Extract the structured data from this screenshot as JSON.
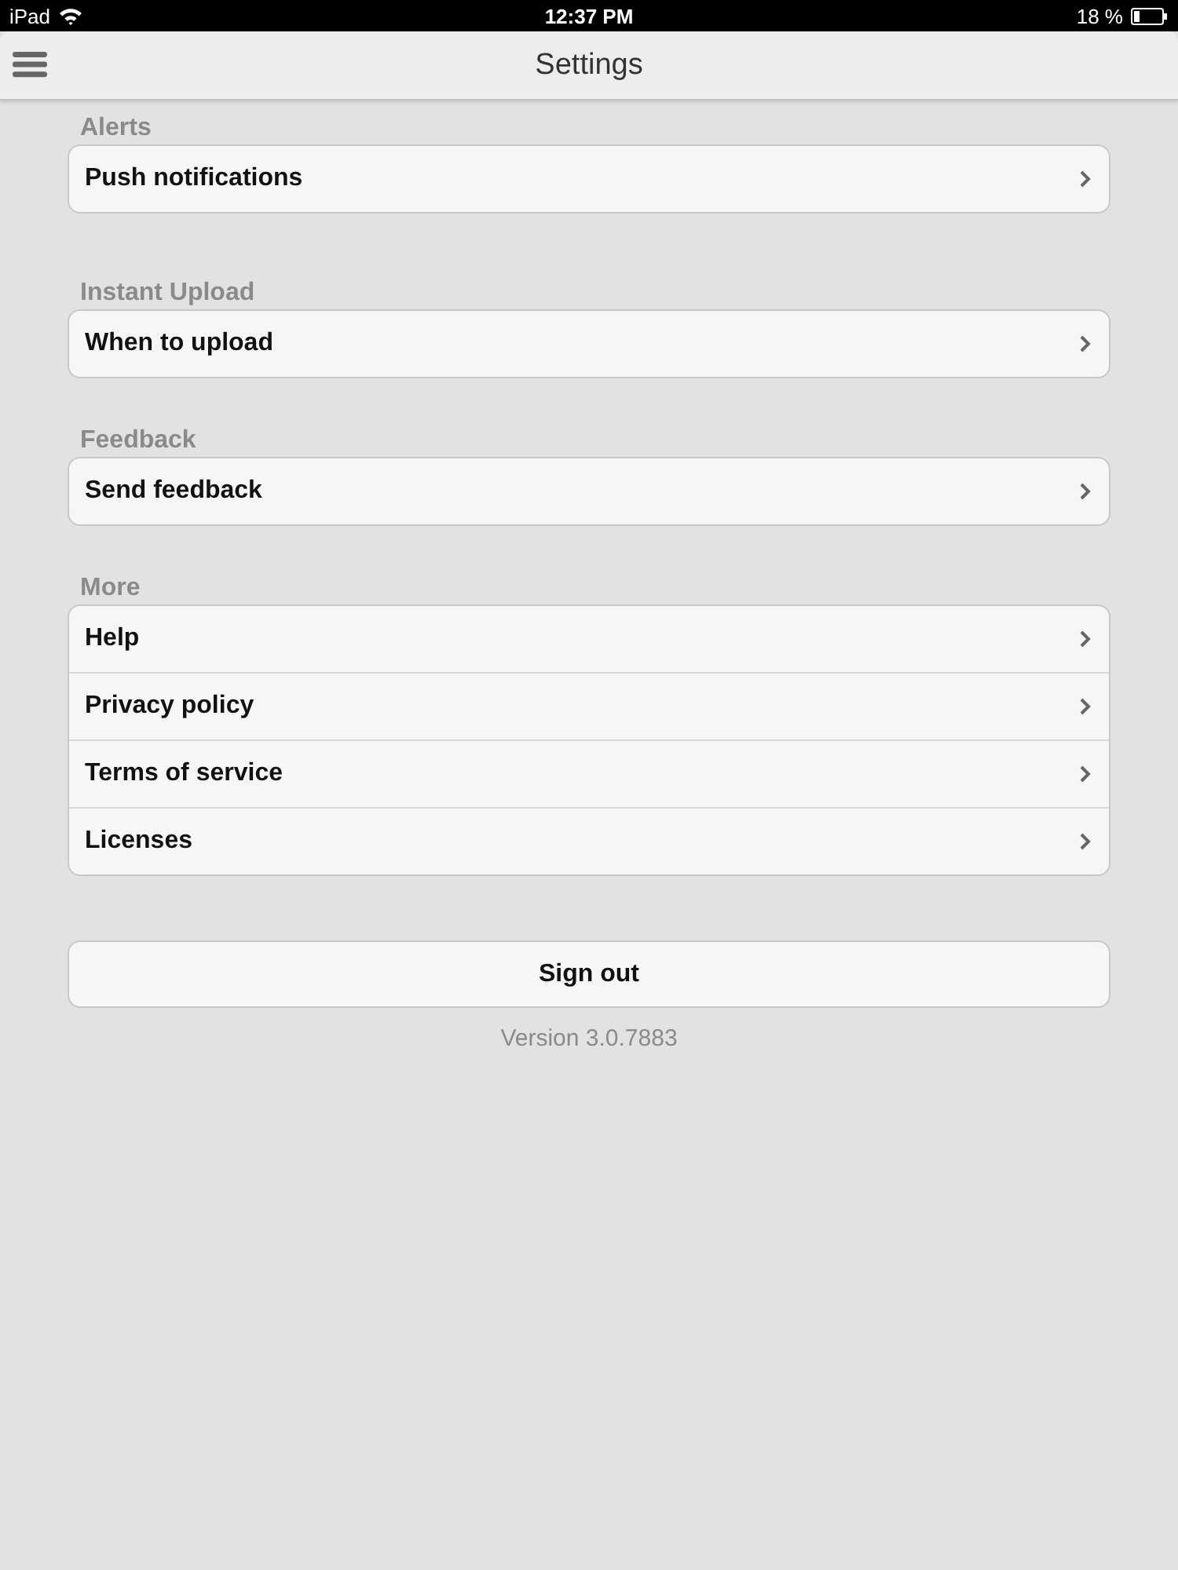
{
  "status_bar": {
    "device": "iPad",
    "time": "12:37 PM",
    "battery": "18 %"
  },
  "nav_bar": {
    "title": "Settings"
  },
  "sections": [
    {
      "header": "Alerts",
      "items": [
        "Push notifications"
      ]
    },
    {
      "header": "Instant Upload",
      "items": [
        "When to upload"
      ]
    },
    {
      "header": "Feedback",
      "items": [
        "Send feedback"
      ]
    },
    {
      "header": "More",
      "items": [
        "Help",
        "Privacy policy",
        "Terms of service",
        "Licenses"
      ]
    }
  ],
  "sign_out": "Sign out",
  "version": "Version 3.0.7883"
}
